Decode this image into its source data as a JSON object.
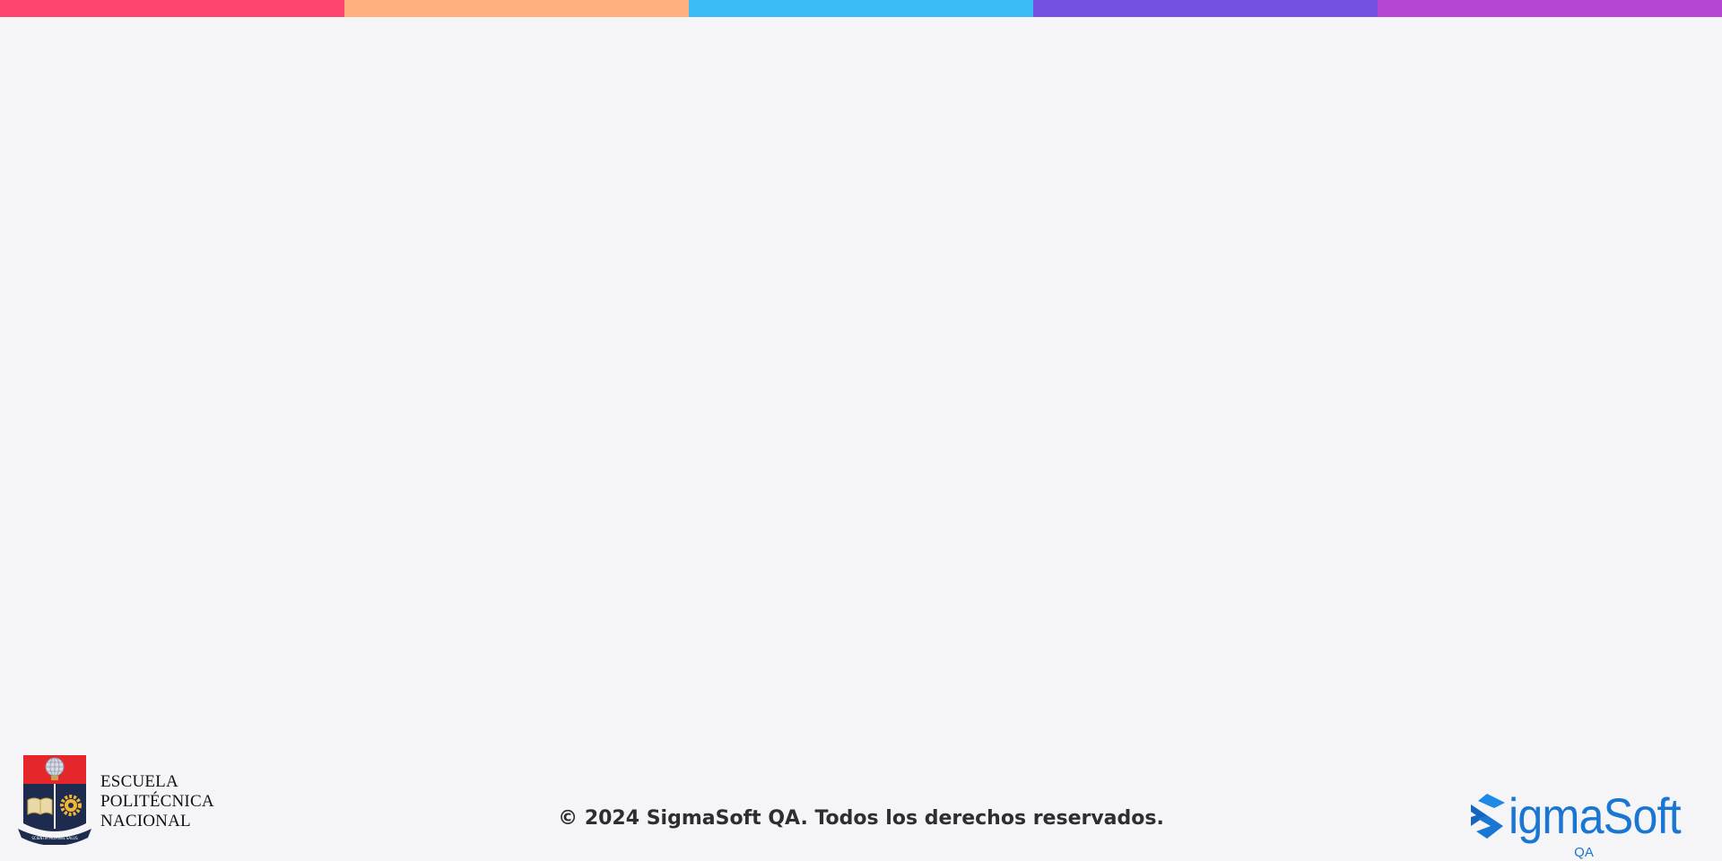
{
  "top_bar": {
    "colors": [
      "#ff4470",
      "#ffb07e",
      "#3bbcf7",
      "#7352e2",
      "#b446d3"
    ]
  },
  "footer": {
    "institution": {
      "lines": [
        "ESCUELA",
        "POLITÉCNICA",
        "NACIONAL"
      ],
      "crest_motto": "SCIENTIA HOMINIS SALUS",
      "icon": "epn-crest-icon"
    },
    "copyright": "© 2024 SigmaSoft QA. Todos los derechos reservados.",
    "brand": {
      "name": "igmaSoft",
      "sub": "QA",
      "icon": "sigma-logo-icon",
      "color": "#1976d2"
    }
  }
}
